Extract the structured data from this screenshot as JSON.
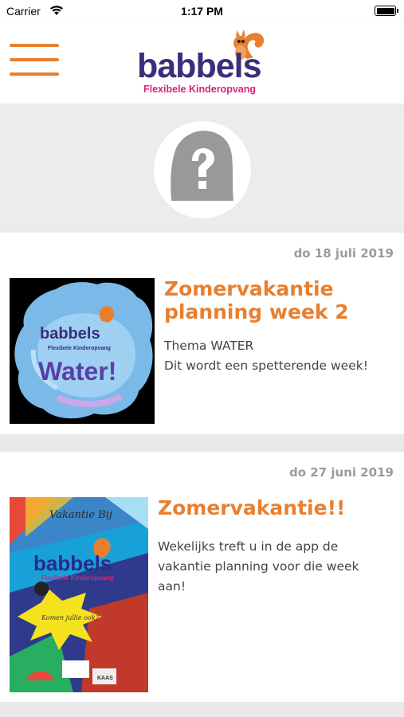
{
  "status_bar": {
    "carrier": "Carrier",
    "time": "1:17 PM"
  },
  "header": {
    "logo_text": "babbels",
    "logo_tagline": "Flexibele Kinderopvang",
    "accent_color": "#e87f2f",
    "brand_color": "#3a2f7a"
  },
  "posts": [
    {
      "date": "do 18 juli 2019",
      "title": "Zomervakantie planning week 2",
      "body_lines": [
        "Thema WATER",
        "Dit wordt een spetterende week!"
      ],
      "image": {
        "brand": "babbels",
        "tagline": "Flexibele Kinderopvang",
        "caption": "Water!"
      }
    },
    {
      "date": "do 27 juni 2019",
      "title": "Zomervakantie!!",
      "body_lines": [
        "Wekelijks treft u in de app de vakantie planning voor die week aan!"
      ],
      "image": {
        "heading": "Vakantie Bij",
        "brand": "babbels",
        "tagline": "Flexibele Kinderopvang",
        "burst_text": "Komen jullie ook?",
        "footer_logo": "KAAS"
      }
    }
  ]
}
